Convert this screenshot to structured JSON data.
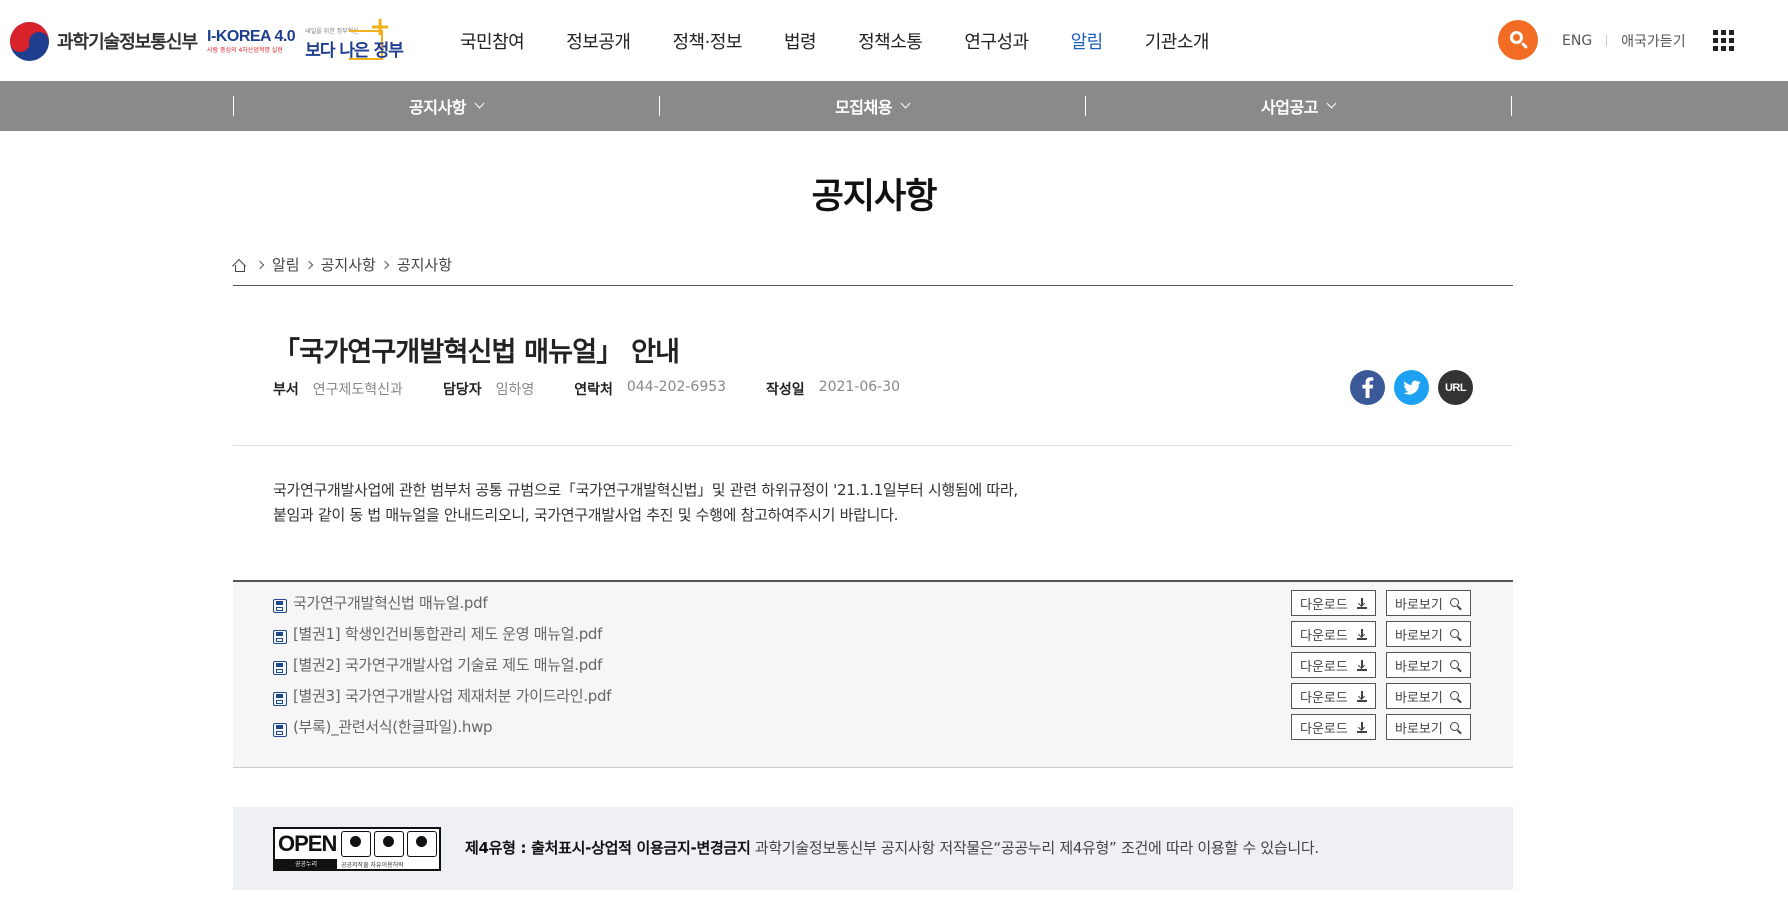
{
  "header": {
    "ministry_name": "과학기술정보통신부",
    "ikorea_logo": "I-KOREA 4.0",
    "ikorea_slogan": "사람 중심의 4차산업혁명 실현",
    "better_gov_tagline": "내일을 위한 정부혁신",
    "better_gov": "보다 나은 정부",
    "nav": [
      {
        "label": "국민참여",
        "active": false
      },
      {
        "label": "정보공개",
        "active": false
      },
      {
        "label": "정책·정보",
        "active": false
      },
      {
        "label": "법령",
        "active": false
      },
      {
        "label": "정책소통",
        "active": false
      },
      {
        "label": "연구성과",
        "active": false
      },
      {
        "label": "알림",
        "active": true
      },
      {
        "label": "기관소개",
        "active": false
      }
    ],
    "search_icon": "search-icon",
    "eng_label": "ENG",
    "anthem_label": "애국가듣기",
    "menu_icon": "grid-menu-icon"
  },
  "subnav": [
    {
      "label": "공지사항"
    },
    {
      "label": "모집채용"
    },
    {
      "label": "사업공고"
    }
  ],
  "page": {
    "title": "공지사항",
    "breadcrumb": [
      "알림",
      "공지사항",
      "공지사항"
    ]
  },
  "post": {
    "title": "「국가연구개발혁신법 매뉴얼」 안내",
    "meta": [
      {
        "key": "부서",
        "value": "연구제도혁신과"
      },
      {
        "key": "담당자",
        "value": "임하영"
      },
      {
        "key": "연락처",
        "value": "044-202-6953"
      },
      {
        "key": "작성일",
        "value": "2021-06-30"
      }
    ],
    "share": {
      "url_label": "URL"
    },
    "body": [
      "국가연구개발사업에 관한 범부처 공통 규범으로「국가연구개발혁신법」및 관련 하위규정이 '21.1.1일부터 시행됨에 따라,",
      "붙임과 같이 동 법 매뉴얼을 안내드리오니, 국가연구개발사업 추진 및 수행에 참고하여주시기 바랍니다."
    ]
  },
  "attachments": {
    "download_label": "다운로드",
    "view_label": "바로보기",
    "files": [
      "국가연구개발혁신법 매뉴얼.pdf",
      "[별권1] 학생인건비통합관리 제도 운영 매뉴얼.pdf",
      "[별권2] 국가연구개발사업 기술료 제도 매뉴얼.pdf",
      "[별권3] 국가연구개발사업 제재처분 가이드라인.pdf",
      "(부록)_관련서식(한글파일).hwp"
    ]
  },
  "license": {
    "logo_open": "OPEN",
    "logo_sub": "공공누리",
    "logo_note": "공공저작물 자유이용허락",
    "type_label": "제4유형 : 출처표시-상업적 이용금지-변경금지",
    "text": " 과학기술정보통신부 공지사항 저작물은“공공누리 제4유형” 조건에 따라 이용할 수 있습니다."
  },
  "colors": {
    "accent_orange": "#f26c23",
    "active_nav": "#1c5fba",
    "subbar": "#8a8a8a",
    "facebook": "#3b5998",
    "twitter": "#1da1f2"
  }
}
